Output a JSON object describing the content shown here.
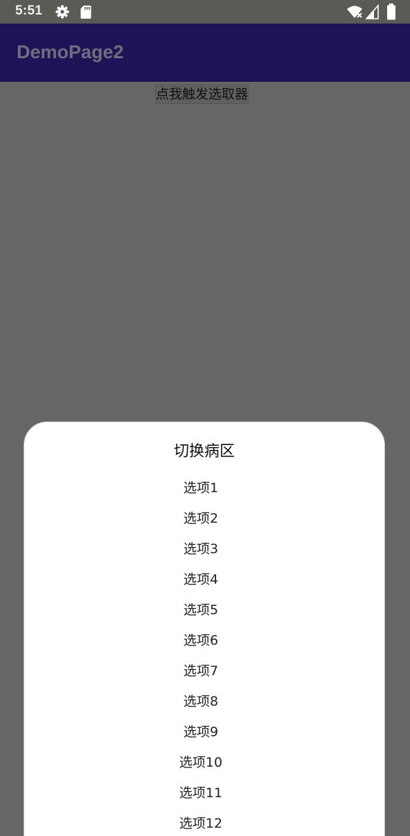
{
  "status_bar": {
    "time": "5:51",
    "icons": [
      "gear-icon",
      "sd-card-icon",
      "wifi-icon",
      "signal-icon",
      "battery-icon"
    ]
  },
  "app_bar": {
    "title": "DemoPage2",
    "background": "#1f1357"
  },
  "trigger": {
    "label": "点我触发选取器"
  },
  "picker": {
    "title": "切换病区",
    "options": [
      "选项1",
      "选项2",
      "选项3",
      "选项4",
      "选项5",
      "选项6",
      "选项7",
      "选项8",
      "选项9",
      "选项10",
      "选项11",
      "选项12"
    ]
  },
  "colors": {
    "scrim": "#666666",
    "sheet": "#ffffff"
  }
}
